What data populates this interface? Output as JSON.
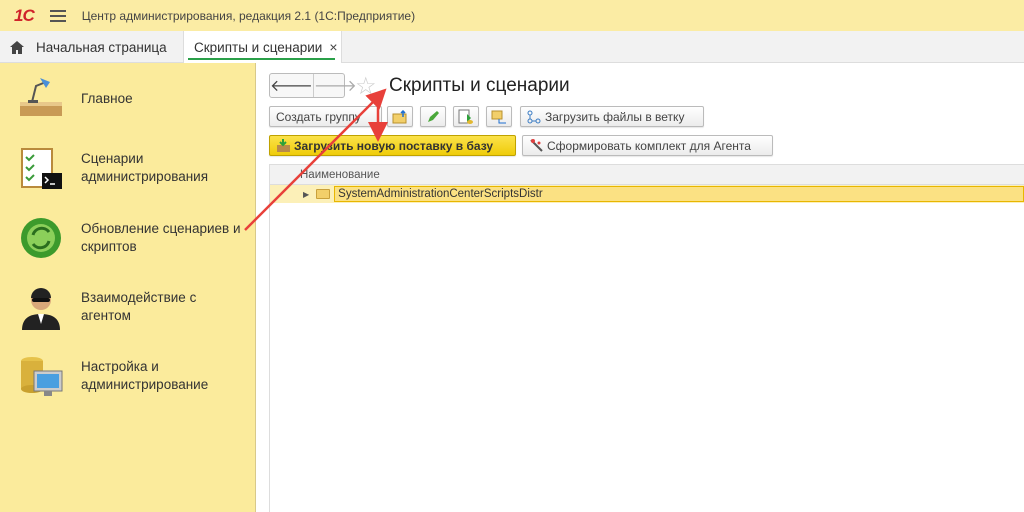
{
  "app": {
    "logo": "1C",
    "title": "Центр администрирования, редакция 2.1  (1С:Предприятие)"
  },
  "tabs": [
    {
      "label": "Начальная страница",
      "icon": "home-icon"
    },
    {
      "label": "Скрипты и сценарии",
      "close": "×",
      "active": true
    }
  ],
  "sidebar": {
    "items": [
      {
        "label": "Главное",
        "icon": "desk-lamp-icon"
      },
      {
        "label": "Сценарии администрирования",
        "icon": "checklist-terminal-icon"
      },
      {
        "label": "Обновление сценариев и скриптов",
        "icon": "green-refresh-icon"
      },
      {
        "label": "Взаимодействие с агентом",
        "icon": "agent-person-icon"
      },
      {
        "label": "Настройка и администрирование",
        "icon": "database-monitor-icon"
      }
    ]
  },
  "page": {
    "title": "Скрипты и сценарии",
    "nav": {
      "back": "🡐",
      "forward": "🡒"
    },
    "toolbar": {
      "create_group": "Создать группу",
      "load_files": "Загрузить файлы в ветку",
      "load_delivery": "Загрузить новую поставку в базу",
      "build_kit": "Сформировать комплект для Агента"
    },
    "table": {
      "column": "Наименование",
      "rows": [
        {
          "name": "SystemAdministrationCenterScriptsDistr"
        }
      ]
    }
  },
  "colors": {
    "titlebar": "#fbeca4",
    "sidebar": "#fbeb9c",
    "accent_yellow": "#f3d41e",
    "annotation_arrow": "#e8403a"
  }
}
